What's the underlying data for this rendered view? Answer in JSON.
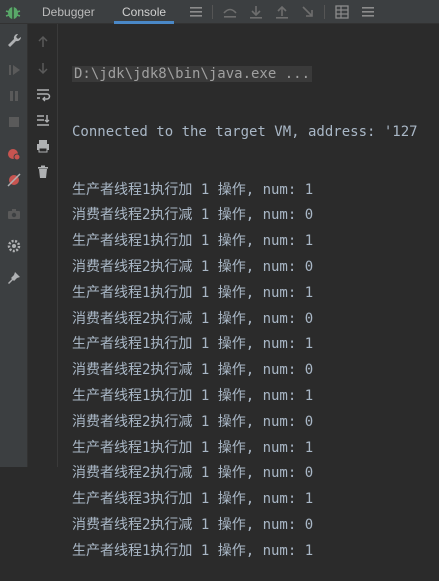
{
  "tabs": [
    {
      "label": "Debugger",
      "active": false
    },
    {
      "label": "Console",
      "active": true
    }
  ],
  "colors": {
    "accent": "#4a88c7",
    "console_text": "#a9b7c6",
    "background": "#2b2b2b",
    "panel": "#3c3f41",
    "stop_red": "#c75450",
    "bug_green": "#59a869"
  },
  "icons": {
    "top": [
      "debug-bug-icon",
      "menu-lines-icon",
      "step-over-icon",
      "step-into-icon",
      "step-out-icon",
      "run-to-cursor-icon",
      "evaluate-icon",
      "table-icon",
      "more-icon"
    ],
    "left_strip": [
      "wrench-icon",
      "resume-icon",
      "pause-icon",
      "stop-icon",
      "breakpoints-icon",
      "mute-breakpoints-icon",
      "camera-icon",
      "settings-icon",
      "pin-icon"
    ],
    "console_strip": [
      "arrow-up-icon",
      "arrow-down-icon",
      "soft-wrap-icon",
      "scroll-to-end-icon",
      "print-icon",
      "trash-icon"
    ]
  },
  "console": {
    "command": "D:\\jdk\\jdk8\\bin\\java.exe ...",
    "connected": "Connected to the target VM, address: '127",
    "lines": [
      "生产者线程1执行加 1 操作, num: 1",
      "消费者线程2执行减 1 操作, num: 0",
      "生产者线程1执行加 1 操作, num: 1",
      "消费者线程2执行减 1 操作, num: 0",
      "生产者线程1执行加 1 操作, num: 1",
      "消费者线程2执行减 1 操作, num: 0",
      "生产者线程1执行加 1 操作, num: 1",
      "消费者线程2执行减 1 操作, num: 0",
      "生产者线程1执行加 1 操作, num: 1",
      "消费者线程2执行减 1 操作, num: 0",
      "生产者线程1执行加 1 操作, num: 1",
      "消费者线程2执行减 1 操作, num: 0",
      "生产者线程3执行加 1 操作, num: 1",
      "消费者线程2执行减 1 操作, num: 0",
      "生产者线程1执行加 1 操作, num: 1"
    ]
  }
}
